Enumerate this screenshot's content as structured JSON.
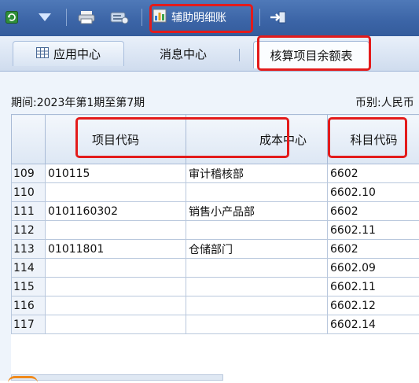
{
  "toolbar": {
    "items": [
      {
        "icon": "refresh-icon"
      },
      {
        "icon": "dropdown-triangle-icon"
      },
      {
        "icon": "print-icon"
      },
      {
        "icon": "export-icon"
      },
      {
        "icon": "ledger-icon",
        "label": "辅助明细账"
      },
      {
        "icon": "exit-icon"
      }
    ]
  },
  "tabs": [
    {
      "label": "应用中心",
      "icon": "grid-icon",
      "active": false
    },
    {
      "label": "消息中心",
      "active": false
    },
    {
      "label": "核算项目余额表",
      "active": true
    }
  ],
  "info": {
    "period": "期间:2023年第1期至第7期",
    "currency": "币别:人民币"
  },
  "table": {
    "columns": [
      "",
      "项目代码",
      "成本中心",
      "科目代码"
    ],
    "rows": [
      {
        "num": "109",
        "code": "010115",
        "center": "审计稽核部",
        "account": "6602"
      },
      {
        "num": "110",
        "code": "",
        "center": "",
        "account": "6602.10"
      },
      {
        "num": "111",
        "code": "0101160302",
        "center": "销售小产品部",
        "account": "6602"
      },
      {
        "num": "112",
        "code": "",
        "center": "",
        "account": "6602.11"
      },
      {
        "num": "113",
        "code": "01011801",
        "center": "仓储部门",
        "account": "6602"
      },
      {
        "num": "114",
        "code": "",
        "center": "",
        "account": "6602.09"
      },
      {
        "num": "115",
        "code": "",
        "center": "",
        "account": "6602.11"
      },
      {
        "num": "116",
        "code": "",
        "center": "",
        "account": "6602.12"
      },
      {
        "num": "117",
        "code": "",
        "center": "",
        "account": "6602.14"
      }
    ]
  },
  "colors": {
    "toolbar": "#3b64a6",
    "highlight": "#e31b1b",
    "accent": "#f08a1c"
  }
}
